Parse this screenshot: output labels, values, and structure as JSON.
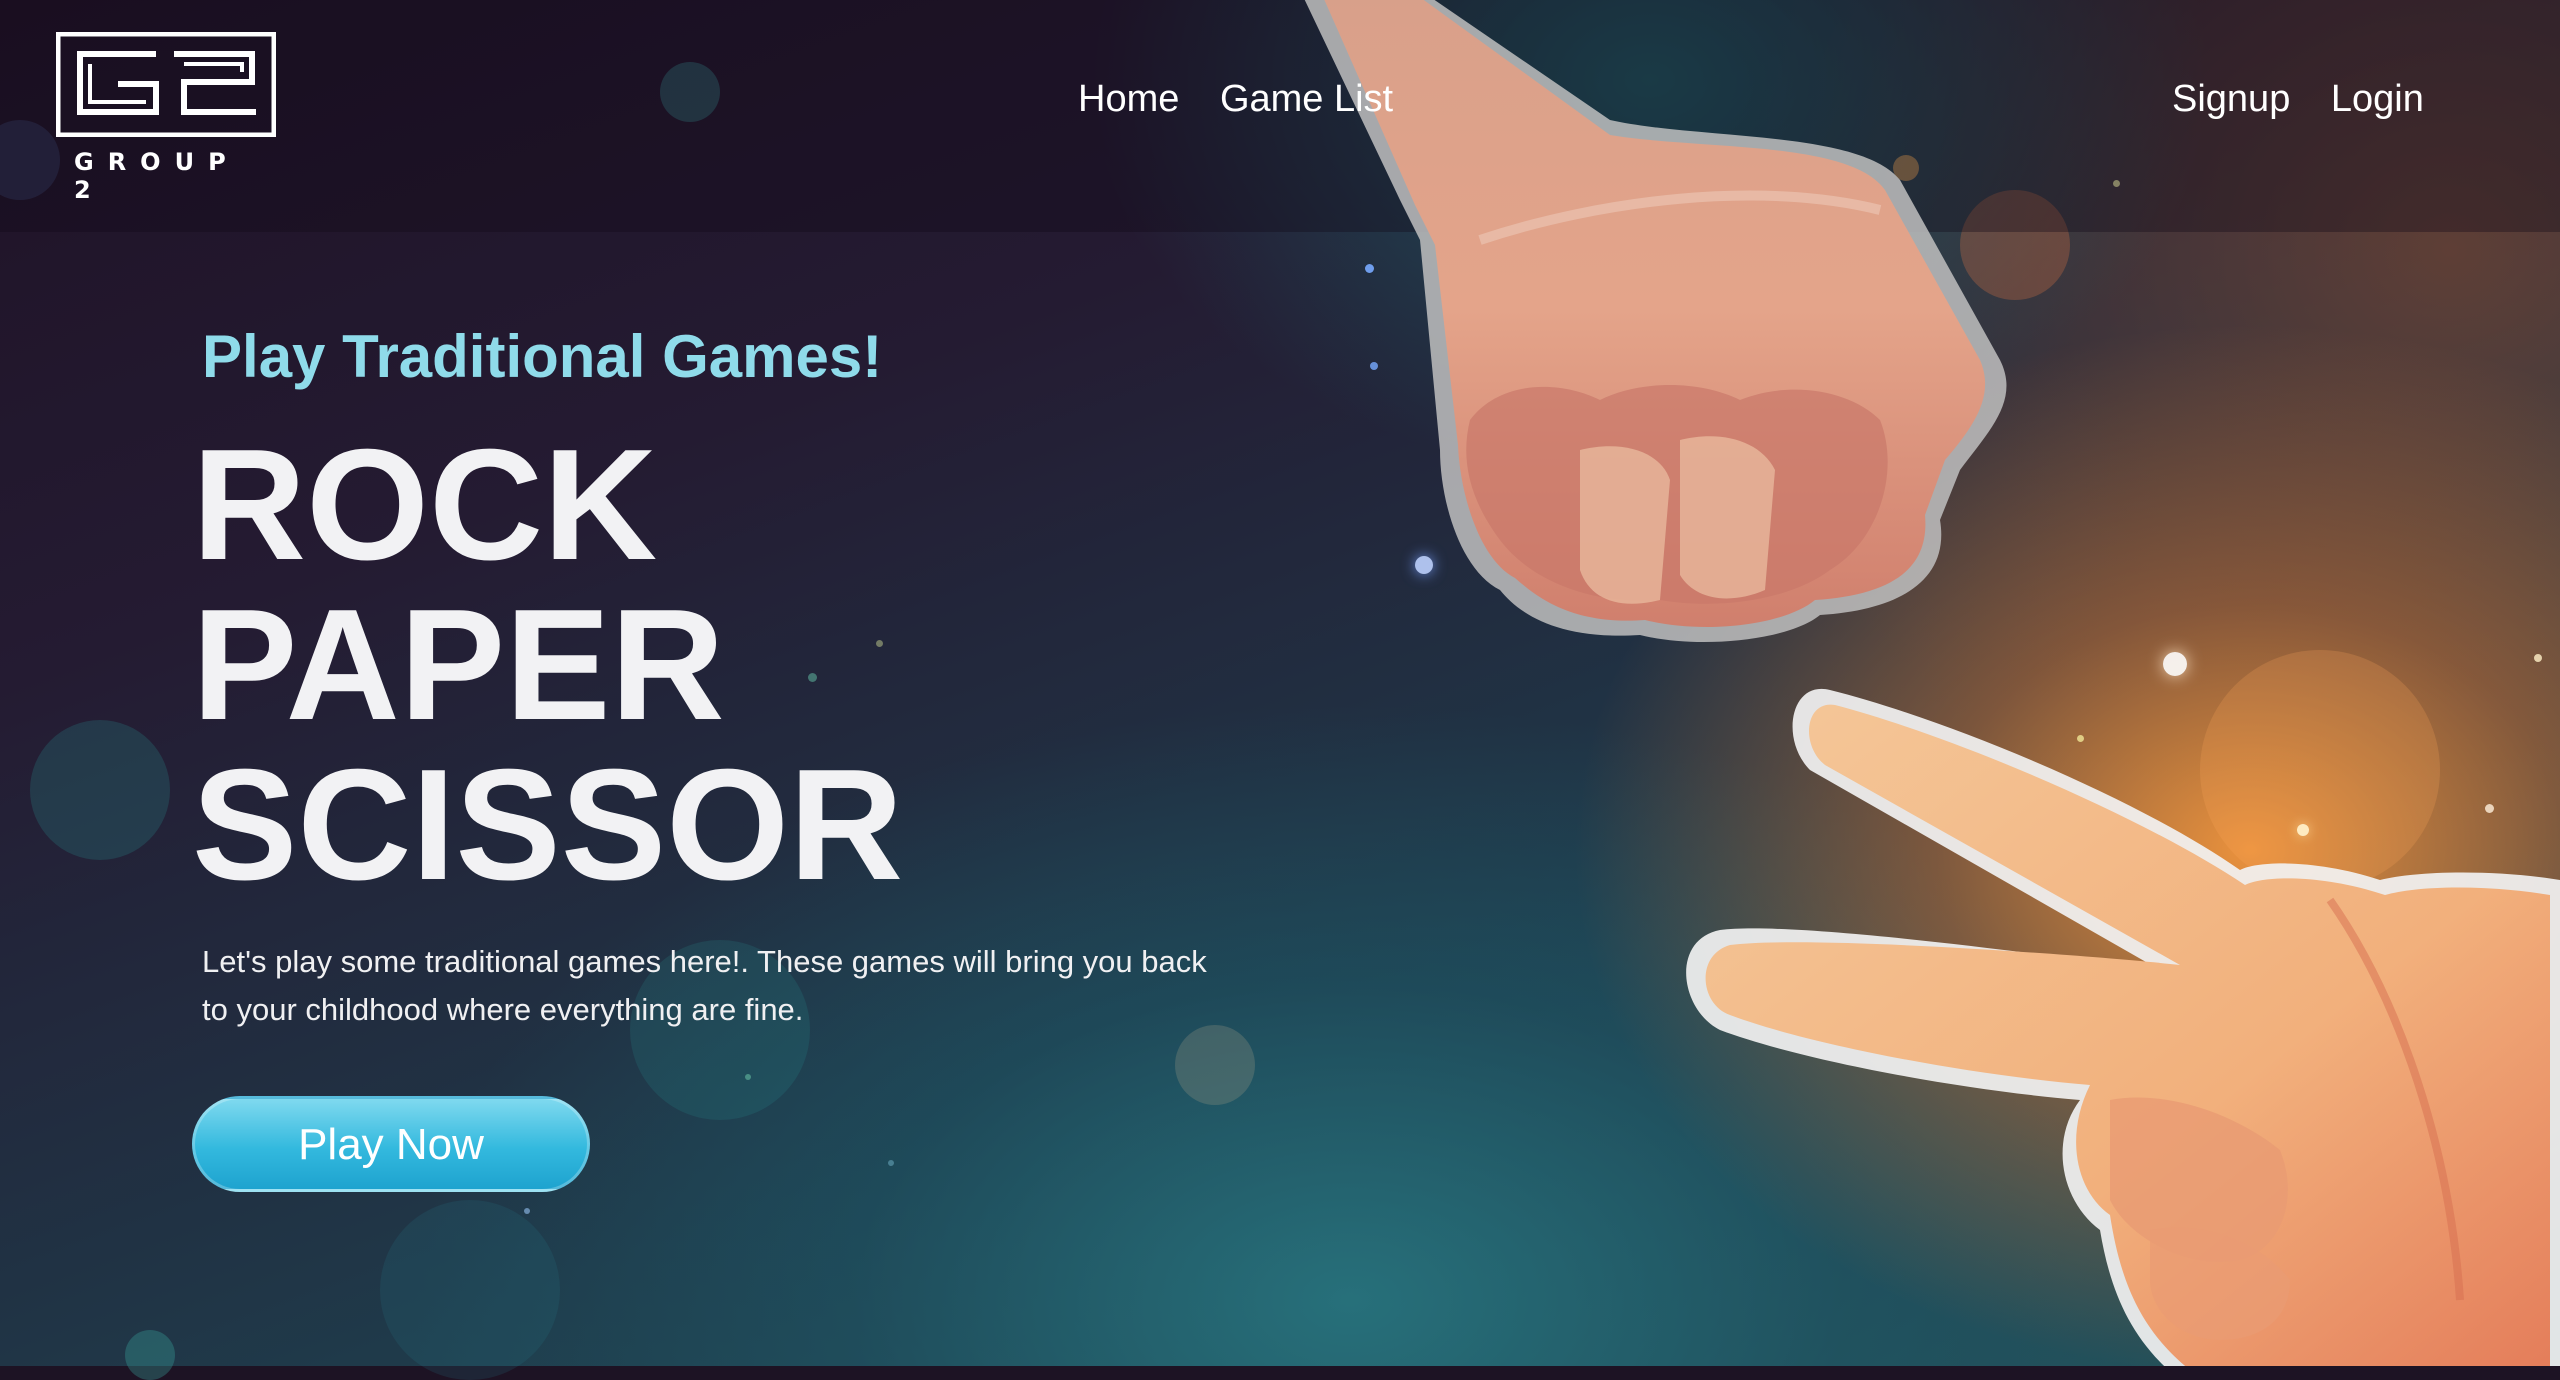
{
  "brand": {
    "logo_mark": "G2",
    "name": "GROUP 2"
  },
  "nav": {
    "main": [
      {
        "label": "Home"
      },
      {
        "label": "Game List"
      }
    ],
    "auth": [
      {
        "label": "Signup"
      },
      {
        "label": "Login"
      }
    ]
  },
  "hero": {
    "eyebrow": "Play Traditional Games!",
    "title_lines": [
      "ROCK",
      "PAPER",
      "SCISSOR"
    ],
    "description": "Let's play some traditional games here!. These games will bring you back to your childhood where everything are fine.",
    "cta_label": "Play Now"
  },
  "theme": {
    "accent": "#8fdbea",
    "button": "#33b9de",
    "background": "#1d1324",
    "glow": "#f5963c"
  },
  "icons": [
    "rock-fist-illustration",
    "scissors-hand-illustration"
  ]
}
